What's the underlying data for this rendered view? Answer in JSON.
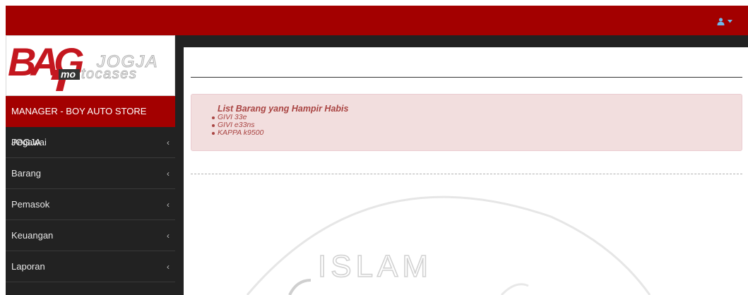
{
  "header": {
    "user_icon": "user-icon",
    "dropdown_icon": "caret-down-icon"
  },
  "logo": {
    "brand_mark": "BAG",
    "line1": "JOGJA",
    "badge": "mo",
    "line2": "tocases"
  },
  "sidebar": {
    "role_title": "MANAGER - BOY AUTO STORE JOGJA",
    "items": [
      {
        "label": "Pegawai",
        "icon": "chevron-left-icon"
      },
      {
        "label": "Barang",
        "icon": "chevron-left-icon"
      },
      {
        "label": "Pemasok",
        "icon": "chevron-left-icon"
      },
      {
        "label": "Keuangan",
        "icon": "chevron-left-icon"
      },
      {
        "label": "Laporan",
        "icon": "chevron-left-icon"
      }
    ]
  },
  "alert": {
    "title": "List Barang yang Hampir Habis",
    "items": [
      "GIVI 33e",
      "GIVI e33ns",
      "KAPPA k9500"
    ]
  },
  "watermark": {
    "text": "ISLAM"
  },
  "colors": {
    "brand_red": "#a30000",
    "sidebar_bg": "#222222",
    "alert_bg": "#f2dede",
    "alert_text": "#a94442"
  }
}
